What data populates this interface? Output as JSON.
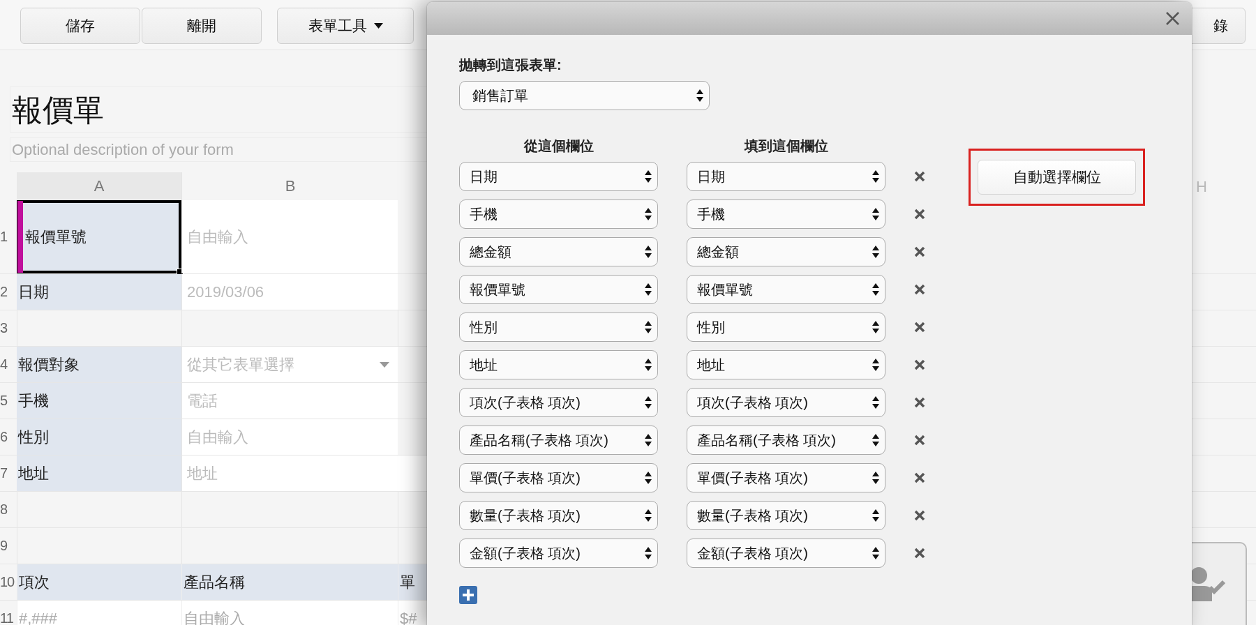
{
  "toolbar": {
    "buttons": [
      {
        "label": "儲存",
        "kind": "plain"
      },
      {
        "label": "離開",
        "kind": "plain"
      },
      {
        "label": "表單工具",
        "kind": "menu"
      }
    ],
    "right_button": "錄"
  },
  "form": {
    "title": "報價單",
    "description_placeholder": "Optional description of your form"
  },
  "sheet": {
    "columns": [
      "A",
      "B"
    ],
    "right_column": "H",
    "rows": [
      {
        "number": "1",
        "kind": "field",
        "label": "報價單號",
        "value": "自由輸入",
        "selected": true
      },
      {
        "number": "2",
        "kind": "field",
        "label": "日期",
        "value": "2019/03/06",
        "selected": false
      },
      {
        "number": "3",
        "kind": "empty",
        "selected": false
      },
      {
        "number": "4",
        "kind": "dropdown",
        "label": "報價對象",
        "value": "從其它表單選擇",
        "selected": false
      },
      {
        "number": "5",
        "kind": "field",
        "label": "手機",
        "value": "電話",
        "selected": false
      },
      {
        "number": "6",
        "kind": "field",
        "label": "性別",
        "value": "自由輸入",
        "selected": false
      },
      {
        "number": "7",
        "kind": "field",
        "label": "地址",
        "value": "地址",
        "selected": false
      },
      {
        "number": "8",
        "kind": "empty",
        "selected": false
      },
      {
        "number": "9",
        "kind": "empty",
        "selected": false
      },
      {
        "number": "10",
        "kind": "header",
        "cells": [
          "項次",
          "產品名稱",
          "單"
        ],
        "selected": false
      },
      {
        "number": "11",
        "kind": "data",
        "cells": [
          "#,###",
          "自由輸入",
          "$#"
        ],
        "selected": false
      }
    ]
  },
  "dialog": {
    "target_label": "抛轉到這張表單:",
    "target_form": "銷售訂單",
    "from_header": "從這個欄位",
    "to_header": "填到這個欄位",
    "auto_button": "自動選擇欄位",
    "mappings": [
      {
        "from": "日期",
        "to": "日期"
      },
      {
        "from": "手機",
        "to": "手機"
      },
      {
        "from": "總金額",
        "to": "總金額"
      },
      {
        "from": "報價單號",
        "to": "報價單號"
      },
      {
        "from": "性別",
        "to": "性別"
      },
      {
        "from": "地址",
        "to": "地址"
      },
      {
        "from": "項次(子表格 項次)",
        "to": "項次(子表格 項次)"
      },
      {
        "from": "產品名稱(子表格 項次)",
        "to": "產品名稱(子表格 項次)"
      },
      {
        "from": "單價(子表格 項次)",
        "to": "單價(子表格 項次)"
      },
      {
        "from": "數量(子表格 項次)",
        "to": "數量(子表格 項次)"
      },
      {
        "from": "金額(子表格 項次)",
        "to": "金額(子表格 項次)"
      }
    ]
  }
}
